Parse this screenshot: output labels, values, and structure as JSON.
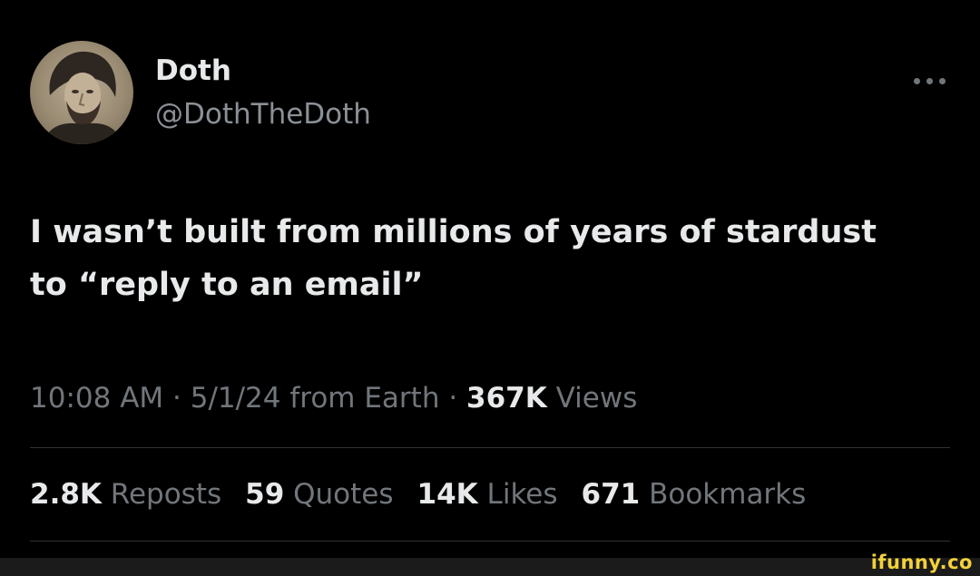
{
  "author": {
    "display_name": "Doth",
    "handle": "@DothTheDoth",
    "avatar": "portrait-avatar"
  },
  "more_icon": "more-horizontal-icon",
  "tweet": {
    "line1": "I wasn’t built from millions of years of stardust",
    "line2": "to “reply to an email”"
  },
  "meta": {
    "time": "10:08 AM",
    "sep1": " · ",
    "date": "5/1/24",
    "source": " from Earth",
    "sep2": " · ",
    "views_count": "367K",
    "views_label": " Views"
  },
  "stats": [
    {
      "count": "2.8K",
      "label": " Reposts"
    },
    {
      "count": "59",
      "label": " Quotes"
    },
    {
      "count": "14K",
      "label": " Likes"
    },
    {
      "count": "671",
      "label": " Bookmarks"
    }
  ],
  "watermark": "ifunny.co",
  "colors": {
    "background": "#000000",
    "primary_text": "#e7e9ea",
    "secondary_text": "#71767b",
    "divider": "#2f3336",
    "watermark": "#f3d13a"
  }
}
